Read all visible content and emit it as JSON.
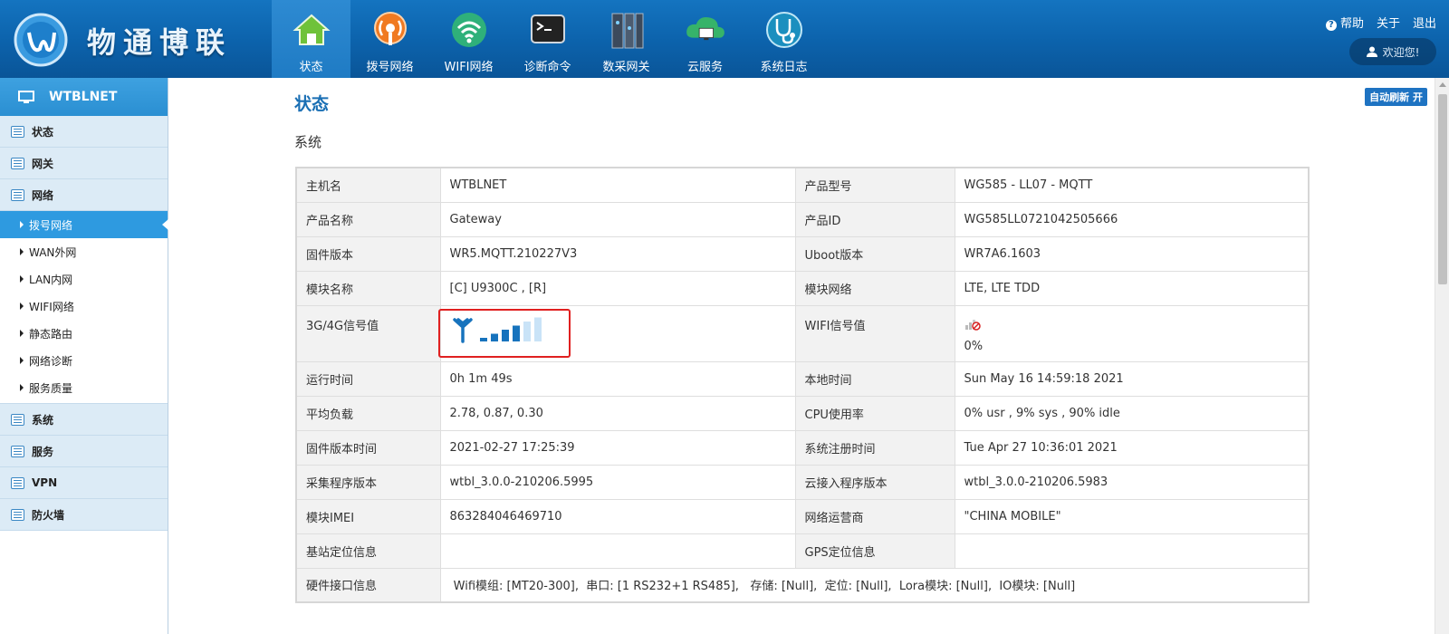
{
  "brand": {
    "name": "物通博联"
  },
  "nav": {
    "items": [
      {
        "label": "状态",
        "icon": "house-icon"
      },
      {
        "label": "拨号网络",
        "icon": "dialup-icon"
      },
      {
        "label": "WIFI网络",
        "icon": "wifi-icon"
      },
      {
        "label": "诊断命令",
        "icon": "terminal-icon"
      },
      {
        "label": "数采网关",
        "icon": "gateway-icon"
      },
      {
        "label": "云服务",
        "icon": "cloud-icon"
      },
      {
        "label": "系统日志",
        "icon": "stethoscope-icon"
      }
    ],
    "active_index": 0
  },
  "top_links": {
    "help": "帮助",
    "about": "关于",
    "logout": "退出",
    "welcome": "欢迎您!"
  },
  "sidebar": {
    "header": "WTBLNET",
    "sections": {
      "status": "状态",
      "gateway": "网关",
      "network": "网络",
      "network_items": [
        "拨号网络",
        "WAN外网",
        "LAN内网",
        "WIFI网络",
        "静态路由",
        "网络诊断",
        "服务质量"
      ],
      "system": "系统",
      "service": "服务",
      "vpn": "VPN",
      "firewall": "防火墙"
    }
  },
  "main": {
    "title": "状态",
    "section": "系统",
    "auto_refresh": "自动刷新 开",
    "rows": [
      {
        "l1": "主机名",
        "v1": "WTBLNET",
        "l2": "产品型号",
        "v2": "WG585 - LL07 - MQTT"
      },
      {
        "l1": "产品名称",
        "v1": "Gateway",
        "l2": "产品ID",
        "v2": "WG585LL0721042505666"
      },
      {
        "l1": "固件版本",
        "v1": "WR5.MQTT.210227V3",
        "l2": "Uboot版本",
        "v2": "WR7A6.1603"
      },
      {
        "l1": "模块名称",
        "v1": "[C] U9300C , [R]",
        "l2": "模块网络",
        "v2": "LTE, LTE TDD"
      },
      {
        "l1": "3G/4G信号值",
        "l2": "WIFI信号值",
        "v2": "0%"
      },
      {
        "l1": "运行时间",
        "v1": "0h 1m 49s",
        "l2": "本地时间",
        "v2": "Sun May 16 14:59:18 2021"
      },
      {
        "l1": "平均负载",
        "v1": "2.78, 0.87, 0.30",
        "l2": "CPU使用率",
        "v2": "0% usr , 9% sys , 90% idle"
      },
      {
        "l1": "固件版本时间",
        "v1": "2021-02-27 17:25:39",
        "l2": "系统注册时间",
        "v2": "Tue Apr 27 10:36:01 2021"
      },
      {
        "l1": "采集程序版本",
        "v1": "wtbl_3.0.0-210206.5995",
        "l2": "云接入程序版本",
        "v2": "wtbl_3.0.0-210206.5983"
      },
      {
        "l1": "模块IMEI",
        "v1": "863284046469710",
        "l2": "网络运营商",
        "v2": "\"CHINA MOBILE\""
      },
      {
        "l1": "基站定位信息",
        "v1": "",
        "l2": "GPS定位信息",
        "v2": ""
      },
      {
        "l1": "硬件接口信息",
        "v1": " Wifi模组: [MT20-300],  串口: [1 RS232+1 RS485],   存储: [Null],  定位: [Null],  Lora模块: [Null],  IO模块: [Null]"
      }
    ],
    "signal_bars_active": 4,
    "signal_bars_total": 6
  },
  "colors": {
    "header": "#0c62ab",
    "accent": "#2e9ae0",
    "title": "#1a6fb4",
    "alert": "#e02020"
  }
}
